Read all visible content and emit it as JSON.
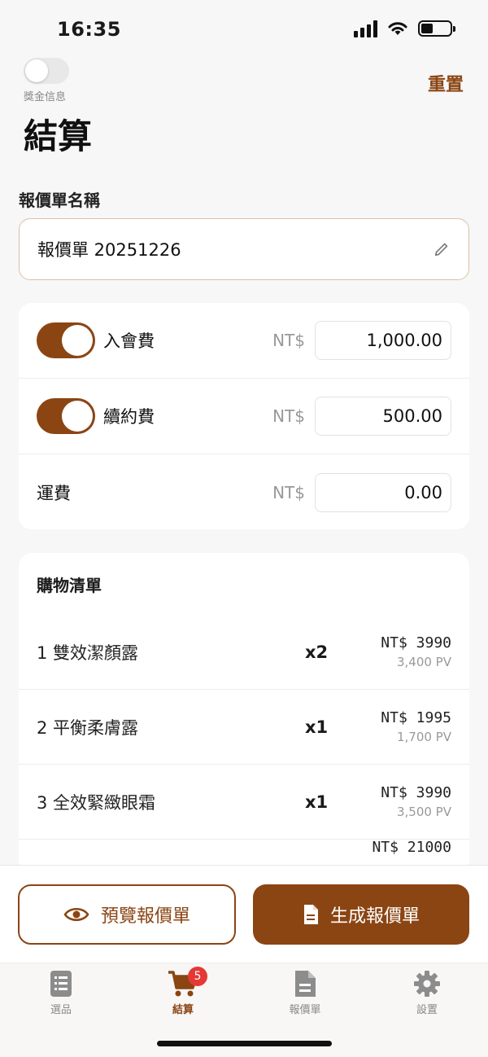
{
  "status_bar": {
    "time": "16:35"
  },
  "header": {
    "bonus_label": "獎金信息",
    "reset_label": "重置",
    "title": "結算"
  },
  "quote_name": {
    "label": "報價單名稱",
    "value": "報價單 20251226"
  },
  "fees": [
    {
      "label": "入會費",
      "currency": "NT$",
      "value": "1,000.00",
      "toggle": true
    },
    {
      "label": "續約費",
      "currency": "NT$",
      "value": "500.00",
      "toggle": true
    },
    {
      "label": "運費",
      "currency": "NT$",
      "value": "0.00",
      "toggle": false
    }
  ],
  "cart": {
    "title": "購物清單",
    "items": [
      {
        "name": "1 雙效潔顏露",
        "qty": "x2",
        "price": "NT$ 3990",
        "pv": "3,400 PV"
      },
      {
        "name": "2 平衡柔膚露",
        "qty": "x1",
        "price": "NT$ 1995",
        "pv": "1,700 PV"
      },
      {
        "name": "3 全效緊緻眼霜",
        "qty": "x1",
        "price": "NT$ 3990",
        "pv": "3,500 PV"
      }
    ],
    "total_peek": "NT$ 21000"
  },
  "actions": {
    "preview_label": "預覽報價單",
    "generate_label": "生成報價單"
  },
  "tabs": [
    {
      "label": "選品",
      "icon": "list-icon"
    },
    {
      "label": "結算",
      "icon": "cart-icon",
      "badge": "5"
    },
    {
      "label": "報價單",
      "icon": "document-icon"
    },
    {
      "label": "設置",
      "icon": "gear-icon"
    }
  ],
  "colors": {
    "accent": "#8b4513",
    "badge": "#e53935"
  }
}
